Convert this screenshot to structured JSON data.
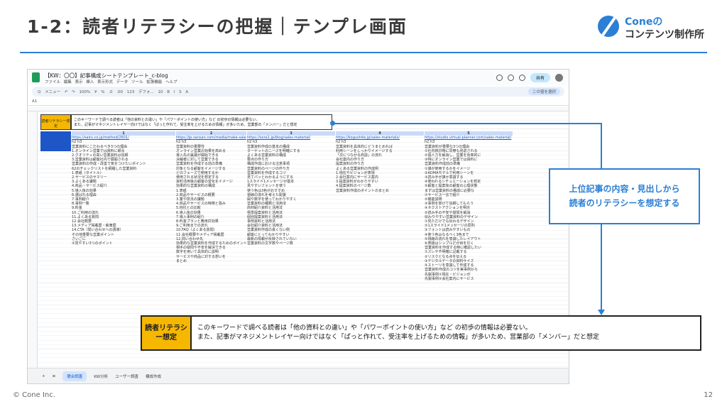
{
  "slide": {
    "title": "1-2：読者リテラシーの把握｜テンプレ画面",
    "logo_line1": "Coneの",
    "logo_line2": "コンテンツ制作所",
    "footer": "© Cone Inc.",
    "page_number": "12",
    "accent_color": "#2b7fd4"
  },
  "sheet": {
    "doc_title": "【KW：〇〇】記事構成シートテンプレート_c-blog",
    "menu": "ファイル 編集 表示 挿入 表示形式 データ ツール 拡張機能 ヘルプ",
    "share_label": "共有",
    "toolbar": "Q メニュー  ↶ ↷  100%  ¥ %  .0  .00  123  デフォ...  10  B I S A",
    "toolbar_pill": "この値を選択",
    "cell_ref": "A1",
    "small_label": "読者リテラシー想定",
    "small_note_line1": "このキーワードで調べる読者は「他の資料との違い」や「パワーポイントの使い方」など の初歩の情報は必要ない。",
    "small_note_line2": "また、記事がマネジメントレイヤー向けではなく「ぱっと作れて、受注率を上げるための情報」が多いため、営業部の「メンバー」だと想定",
    "columns": [
      {
        "num": "1",
        "url": "https://sairu.co.jp/method/2601/",
        "lines": [
          "h2 h3",
          "営業資料にこだわるべき3つの理由",
          "1.オンライン営業では資料に頼る",
          "2.クオリティの高い営業資料は信頼",
          "3.営業資料は顧客社内で展開される",
          "営業資料の作成・改善で気をつけたいポイント",
          "62のチェックリストを網羅した営業資料",
          "1.表紙（タイトル）",
          "2.サービスのサマリー",
          "3.よくある課題",
          "4.商品・サービス紹介",
          "5.導入後の効果",
          "6.選ばれる理由",
          "7.事例紹介",
          "8.事例一覧",
          "9.料金",
          "10.ご利用の流れ",
          "11.よくある質問",
          "12.会社概要",
          "13.メディア掲載歴・執筆歴",
          "14.CTA（問い合わせへの誘導）",
          "その他重要な営業ポイント",
          "さいごに",
          "②見やすい3つのポイント"
        ]
      },
      {
        "num": "2",
        "url": "https://jp.sansan.com/media/make-sales-materials/",
        "lines": [
          "h2 h3",
          "営業資料の重要性",
          "オンライン営業の効果を高める",
          "導入先の稟議が開始できる",
          "決裁者に対して営業できる",
          "営業資料を作成する前の準備",
          "対象となる顧客をイメージする",
          "どのフェーズで使用するか",
          "使用される状況を想定する",
          "資料活用後の顧客の変化をイメージ",
          "効果的な営業資料の構成",
          "1.表紙",
          "2.商品やサービスの概要",
          "3.業や技法の課題",
          "4.商品やサービスの特徴と強み",
          "5.他社との比較",
          "6.導入後の効果",
          "7.導入事例の紹介",
          "8.料金プランと費用対効果",
          "9.ご利用までの流れ",
          "10.FAQ（よくある質問）",
          "11.会社概要やメディア掲載歴",
          "12.問い合わせ先",
          "効果的な営業資料を作成するためのポイント",
          "相手の疑問や不安を解決できる",
          "数字を用いて具体的に説明",
          "サービスや商品に対する想いを",
          "まとめ"
        ]
      },
      {
        "num": "3",
        "url": "https://sora1.jp/blog/sales-material/",
        "lines": [
          "h2 h3",
          "営業資料作成の基本の構成",
          "ターゲットのニーズを明確にする",
          "よくある営業資料の構成",
          "要点の作り方",
          "構成作成における注意事項",
          "営業資料のページの作り方",
          "営業資料を作成するコツ",
          "見てパッとわかるようにする",
          "1スライド1メッセージが基本",
          "見やすいフォントを使う",
          "使う色は3色がおすすめ",
          "視線の流れを考えた配置",
          "図や数字を使ってわかりやすく",
          "営業資料の種類と活用法",
          "商材紹介資料と活用法",
          "標準提案資料と活用法",
          "個別提案資料と活用法",
          "事例資料と活用法",
          "会社紹介資料と活用法",
          "営業資料作成の良くない例",
          "顧客にとってわかりやすい",
          "最新の情報が反映されていない",
          "営業資料の文字数やページ数"
        ]
      },
      {
        "num": "4",
        "url": "https://kogushite.jp/sales-materials/",
        "lines": [
          "h2 h3",
          "営業資料を具体的にどうまとめれば",
          "利用シーンをしっかりイメージする",
          "「次につながる商談」の流れ",
          "会社案内の作り方",
          "提案資料の作り方",
          "よくある営業資料の作成例",
          "1.現在やビジョンが表現",
          "2.会社案内にサービス案内",
          "3.提案資料がわかりやすい",
          "4.提案資料のページ数",
          "営業資料作成のポイントのまとめ"
        ]
      },
      {
        "num": "5",
        "url": "https://studio.virtual-planner.com/sales-material/",
        "lines": [
          "h2 h3",
          "営業資料が重要な3つの理由",
          "①社内検討時に同僚も見返される",
          "②個人力を解消し、営業を効率的に",
          "③特にオンライン営業では資料に",
          "営業資料作成前の準備",
          "①誰が使用するかをイメージ",
          "②ADMAモデルで利用シーンを",
          "③読み手が誰か意識する",
          "④使われるシチュエーションを想定",
          "⑤顧客と提案後の顧客の心理状態",
          "まずは営業資料の構成に必要な",
          "①サービス一言で紹介",
          "②機能説明",
          "③事例を挙げて信頼してもらう",
          "④ネクストアクションを明示",
          "⑤読み手の不安や疑問を解消",
          "伝わりやすい営業資料のデザイン",
          "①見ただけでも伝わるデザイン",
          "②1スライド1メッセージの原則",
          "③フォントは読みやすいもの",
          "④使う色はなるべく3色まで",
          "⑤視線の流れを意識したレイアウト",
          "⑥表組はシンプルだが目を引く",
          "営業資料を作成する時に確認したい",
          "①ズレや不明確に記載する",
          "②リスクとなる点を伝える",
          "③デジタルデータの資料サイズ",
          "④ストーリを意識して作成する",
          "営業資料作成のコツを実事例から",
          "先製事例①現在・ビジョンが",
          "先製事例②会社案内にサービス"
        ]
      }
    ],
    "tabs": [
      "+",
      "≡",
      "競合調査",
      "KW分析",
      "ユーザー調査",
      "構成作成"
    ]
  },
  "callout": {
    "label": "読者リテラシー想定",
    "line1": "このキーワードで調べる読者は「他の資料との違い」や「パワーポイントの使い方」など の初歩の情報は必要ない。",
    "line2": "また、記事がマネジメントレイヤー向けではなく「ぱっと作れて、受注率を上げるための情報」が多いため、営業部の「メンバー」だと想定"
  },
  "annotation": {
    "line1": "上位記事の内容・見出しから",
    "line2": "読者のリテラシーを想定する"
  }
}
